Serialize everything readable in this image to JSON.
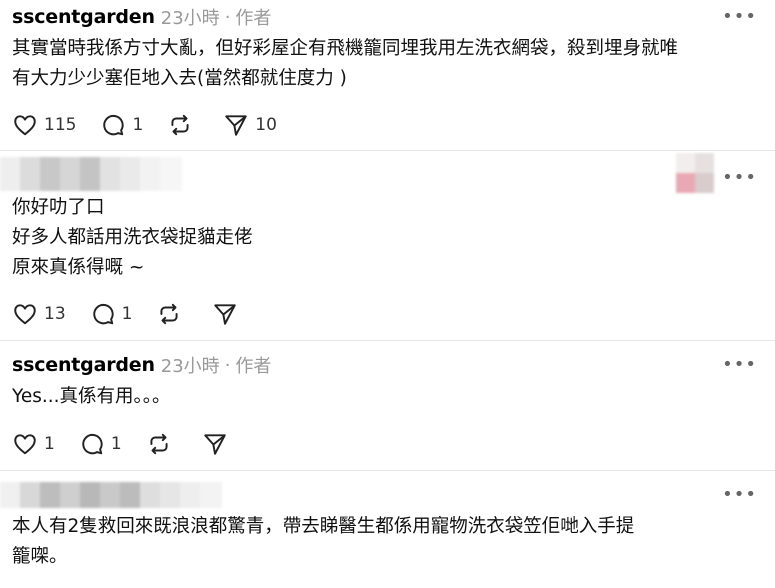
{
  "comments": [
    {
      "username": "sscentgarden",
      "time": "23小時",
      "role": "作者",
      "lines": [
        "其實當時我係方寸大亂，但好彩屋企有飛機籠同埋我用左洗衣網袋，殺到埋身就唯",
        "有大力少少塞佢地入去(當然都就住度力 )"
      ],
      "likes": "115",
      "replies": "1",
      "reposts": "",
      "shares": "10"
    },
    {
      "username": "",
      "lines": [
        "你好叻了口",
        "好多人都話用洗衣袋捉貓走佬",
        "原來真係得嘅 ~"
      ],
      "likes": "13",
      "replies": "1",
      "reposts": "",
      "shares": ""
    },
    {
      "username": "sscentgarden",
      "time": "23小時",
      "role": "作者",
      "lines": [
        "Yes...真係有用。。。"
      ],
      "likes": "1",
      "replies": "1",
      "reposts": "",
      "shares": ""
    },
    {
      "username": "",
      "lines": [
        "本人有2隻救回來既浪浪都驚青，帶去睇醫生都係用寵物洗衣袋笠佢哋入手提",
        "籠㗎。"
      ]
    }
  ],
  "icons": {
    "like": "heart-icon",
    "reply": "comment-icon",
    "repost": "repost-icon",
    "share": "send-icon",
    "more": "more-icon"
  },
  "more_label": "•••",
  "colors": {
    "meta": "#999999",
    "divider": "#e6e6e6"
  }
}
